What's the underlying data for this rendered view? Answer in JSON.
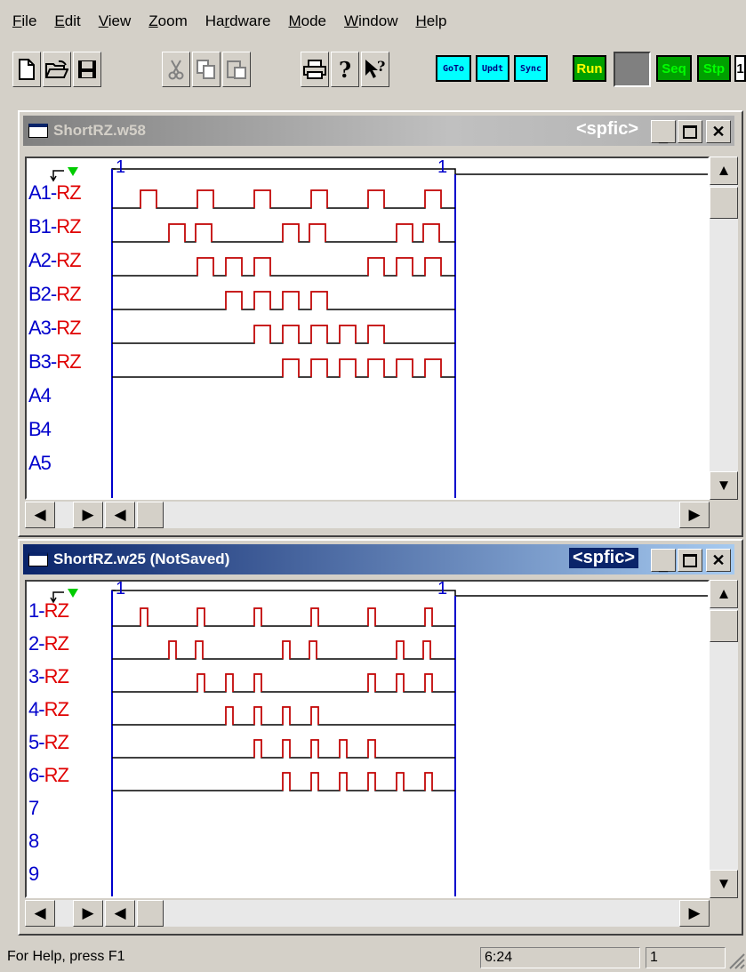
{
  "menu": [
    "File",
    "Edit",
    "View",
    "Zoom",
    "Hardware",
    "Mode",
    "Window",
    "Help"
  ],
  "menu_underline": [
    "F",
    "E",
    "V",
    "Z",
    "r",
    "M",
    "W",
    "H"
  ],
  "toolbar": {
    "icons": [
      "new-icon",
      "open-icon",
      "save-icon",
      "cut-icon",
      "copy-icon",
      "paste-icon",
      "print-icon",
      "help-icon",
      "context-help-icon"
    ],
    "goto_label": "GoTo",
    "updt_label": "Updt",
    "sync_label": "Sync",
    "run_label": "Run",
    "seq_label": "Seq",
    "stp_label": "Stp",
    "trailing_label": "1"
  },
  "window1": {
    "title": "ShortRZ.w58",
    "tag": "<spfic>",
    "marker_left": "1",
    "marker_right": "1",
    "signals": [
      {
        "prefix": "A1-",
        "suffix": "RZ"
      },
      {
        "prefix": "B1-",
        "suffix": "RZ"
      },
      {
        "prefix": "A2-",
        "suffix": "RZ"
      },
      {
        "prefix": "B2-",
        "suffix": "RZ"
      },
      {
        "prefix": "A3-",
        "suffix": "RZ"
      },
      {
        "prefix": "B3-",
        "suffix": "RZ"
      },
      {
        "prefix": "A4",
        "suffix": ""
      },
      {
        "prefix": "B4",
        "suffix": ""
      },
      {
        "prefix": "A5",
        "suffix": ""
      }
    ]
  },
  "window2": {
    "title": "ShortRZ.w25 (NotSaved)",
    "tag": "<spfic>",
    "marker_left": "1",
    "marker_right": "1",
    "signals": [
      {
        "prefix": "1-",
        "suffix": "RZ"
      },
      {
        "prefix": "2-",
        "suffix": "RZ"
      },
      {
        "prefix": "3-",
        "suffix": "RZ"
      },
      {
        "prefix": "4-",
        "suffix": "RZ"
      },
      {
        "prefix": "5-",
        "suffix": "RZ"
      },
      {
        "prefix": "6-",
        "suffix": "RZ"
      },
      {
        "prefix": "7",
        "suffix": ""
      },
      {
        "prefix": "8",
        "suffix": ""
      },
      {
        "prefix": "9",
        "suffix": ""
      }
    ]
  },
  "status": {
    "help_text": "For Help, press F1",
    "position": "6:24",
    "page": "1"
  },
  "colors": {
    "signal_name": "#0000cc",
    "signal_suffix": "#e00000",
    "pulse_color": "#e00000",
    "marker_line": "#0000cc",
    "active_title": "#0a246a"
  }
}
